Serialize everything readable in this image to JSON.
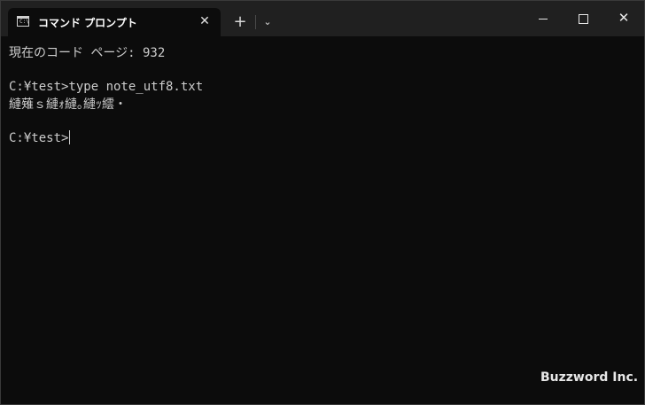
{
  "window": {
    "tab_title": "コマンド プロンプト",
    "tab_icon": "console-icon",
    "tab_icon_prompt": "C:\\",
    "tab_close_glyph": "✕",
    "new_tab_glyph": "+",
    "dropdown_glyph": "⌄",
    "close_glyph": "✕"
  },
  "console": {
    "lines": [
      "現在のコード ページ: 932",
      "C:¥test>type note_utf8.txt",
      "縺薙ｓ縺ｫ縺｡縺ｯ繧・",
      "C:¥test>"
    ]
  },
  "watermark": "Buzzword Inc."
}
